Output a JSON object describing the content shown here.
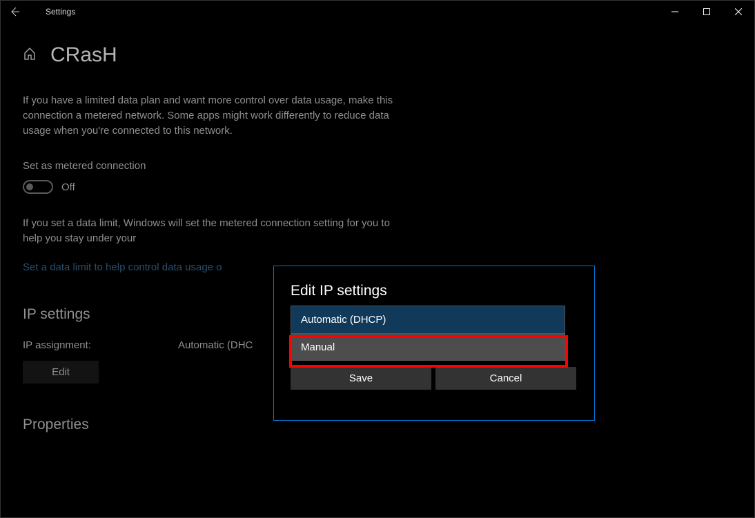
{
  "window": {
    "title": "Settings"
  },
  "page": {
    "title": "CRasH",
    "description": "If you have a limited data plan and want more control over data usage, make this connection a metered network. Some apps might work differently to reduce data usage when you're connected to this network.",
    "metered_label": "Set as metered connection",
    "toggle_state": "Off",
    "data_limit_desc": "If you set a data limit, Windows will set the metered connection setting for you to help you stay under your",
    "data_limit_link": "Set a data limit to help control data usage o",
    "ip_section_heading": "IP settings",
    "ip_assignment_key": "IP assignment:",
    "ip_assignment_val": "Automatic (DHC",
    "edit_button": "Edit",
    "properties_heading": "Properties"
  },
  "dialog": {
    "title": "Edit IP settings",
    "option_auto": "Automatic (DHCP)",
    "option_manual": "Manual",
    "save_button": "Save",
    "cancel_button": "Cancel"
  }
}
